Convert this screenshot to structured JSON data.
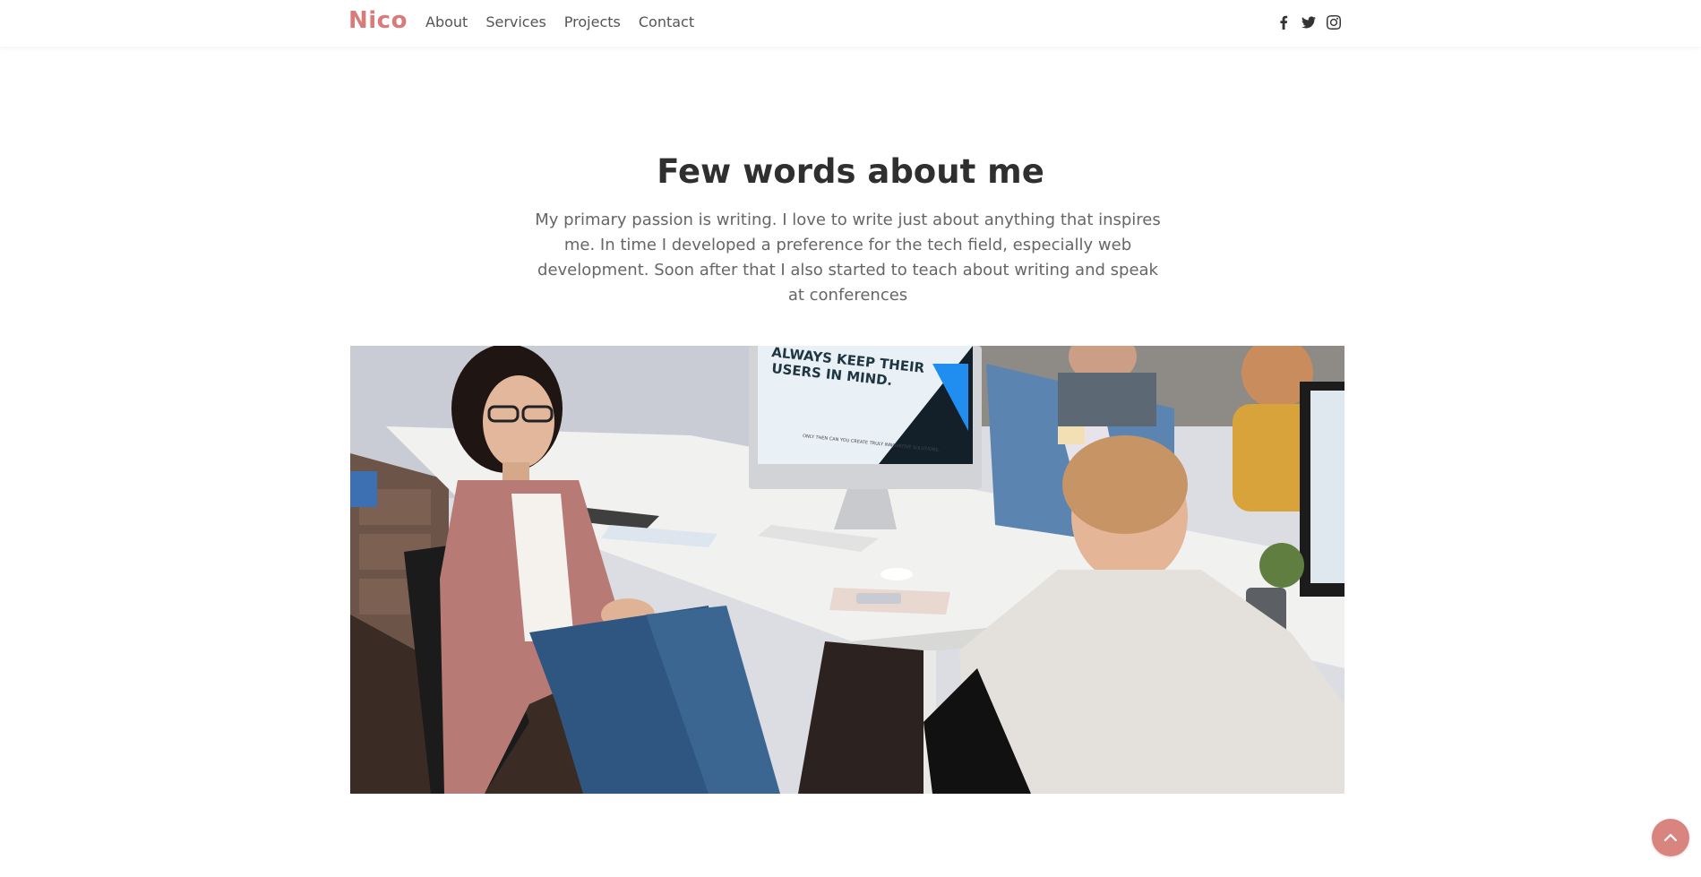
{
  "colors": {
    "brand": "#d97b7b",
    "heading": "#2f2f2f",
    "body_text": "#666666",
    "nav_text": "#555555",
    "back_to_top_bg": "#d9847f"
  },
  "nav": {
    "brand": "Nico",
    "links": [
      {
        "label": "About"
      },
      {
        "label": "Services"
      },
      {
        "label": "Projects"
      },
      {
        "label": "Contact"
      }
    ],
    "social": [
      {
        "icon": "facebook-icon"
      },
      {
        "icon": "twitter-icon"
      },
      {
        "icon": "instagram-icon"
      }
    ]
  },
  "about": {
    "title": "Few words about me",
    "paragraph": "My primary passion is writing. I love to write just about anything that inspires me. In time I developed a preference for the tech field, especially web development. Soon after that I also started to teach about writing and speak at conferences",
    "image": {
      "screen_line1": "ALWAYS KEEP THEIR",
      "screen_line2": "USERS IN MIND.",
      "screen_small": "ONLY THEN CAN YOU CREATE TRULY INNOVATIVE SOLUTIONS."
    }
  },
  "back_to_top": {
    "icon": "chevron-up-icon"
  }
}
